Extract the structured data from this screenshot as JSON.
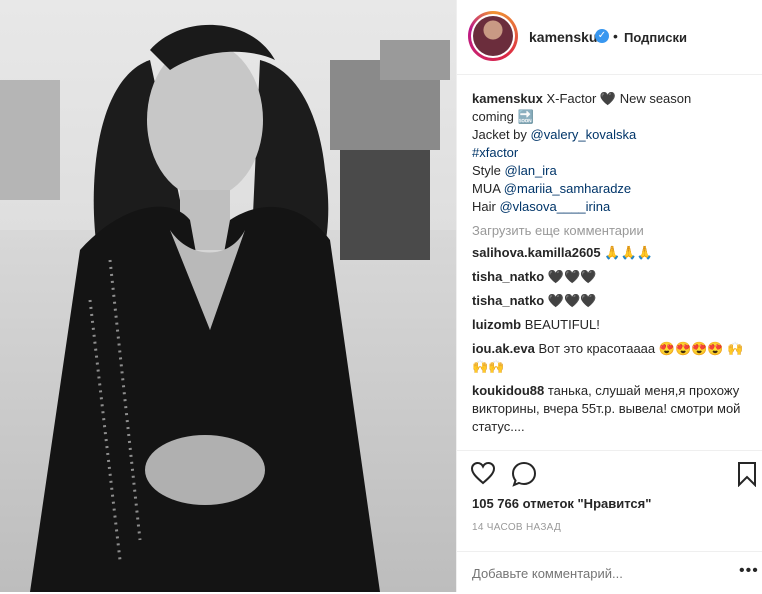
{
  "post": {
    "username": "kamenskux",
    "separator": "•",
    "follow_label": "Подписки",
    "caption": {
      "author": "kamenskux",
      "line1": "X-Factor 🖤 New season",
      "line2": "coming 🔜",
      "jacket_prefix": "Jacket by ",
      "jacket_link": "@valery_kovalska",
      "hashtag": "#xfactor",
      "style_prefix": "Style ",
      "style_link": "@lan_ira",
      "mua_prefix": "MUA ",
      "mua_link": "@mariia_samharadze",
      "hair_prefix": "Hair ",
      "hair_link": "@vlasova____irina"
    },
    "load_more": "Загрузить еще комментарии",
    "comments": [
      {
        "user": "salihova.kamilla2605",
        "text": "🙏🙏🙏"
      },
      {
        "user": "tisha_natko",
        "text": "🖤🖤🖤"
      },
      {
        "user": "tisha_natko",
        "text": "🖤🖤🖤"
      },
      {
        "user": "luizomb",
        "text": "BEAUTIFUL!"
      },
      {
        "user": "iou.ak.eva",
        "text": "Вот это красотаааа 😍😍😍😍 🙌🙌🙌"
      },
      {
        "user": "koukidou88",
        "text": "танька, слушай меня,я прохожу викторины, вчера 55т.р. вывела! смотри мой статус...."
      }
    ],
    "likes": "105 766 отметок \"Нравится\"",
    "time": "14 ЧАСОВ НАЗАД",
    "add_comment_placeholder": "Добавьте комментарий...",
    "more_icon": "•••"
  }
}
